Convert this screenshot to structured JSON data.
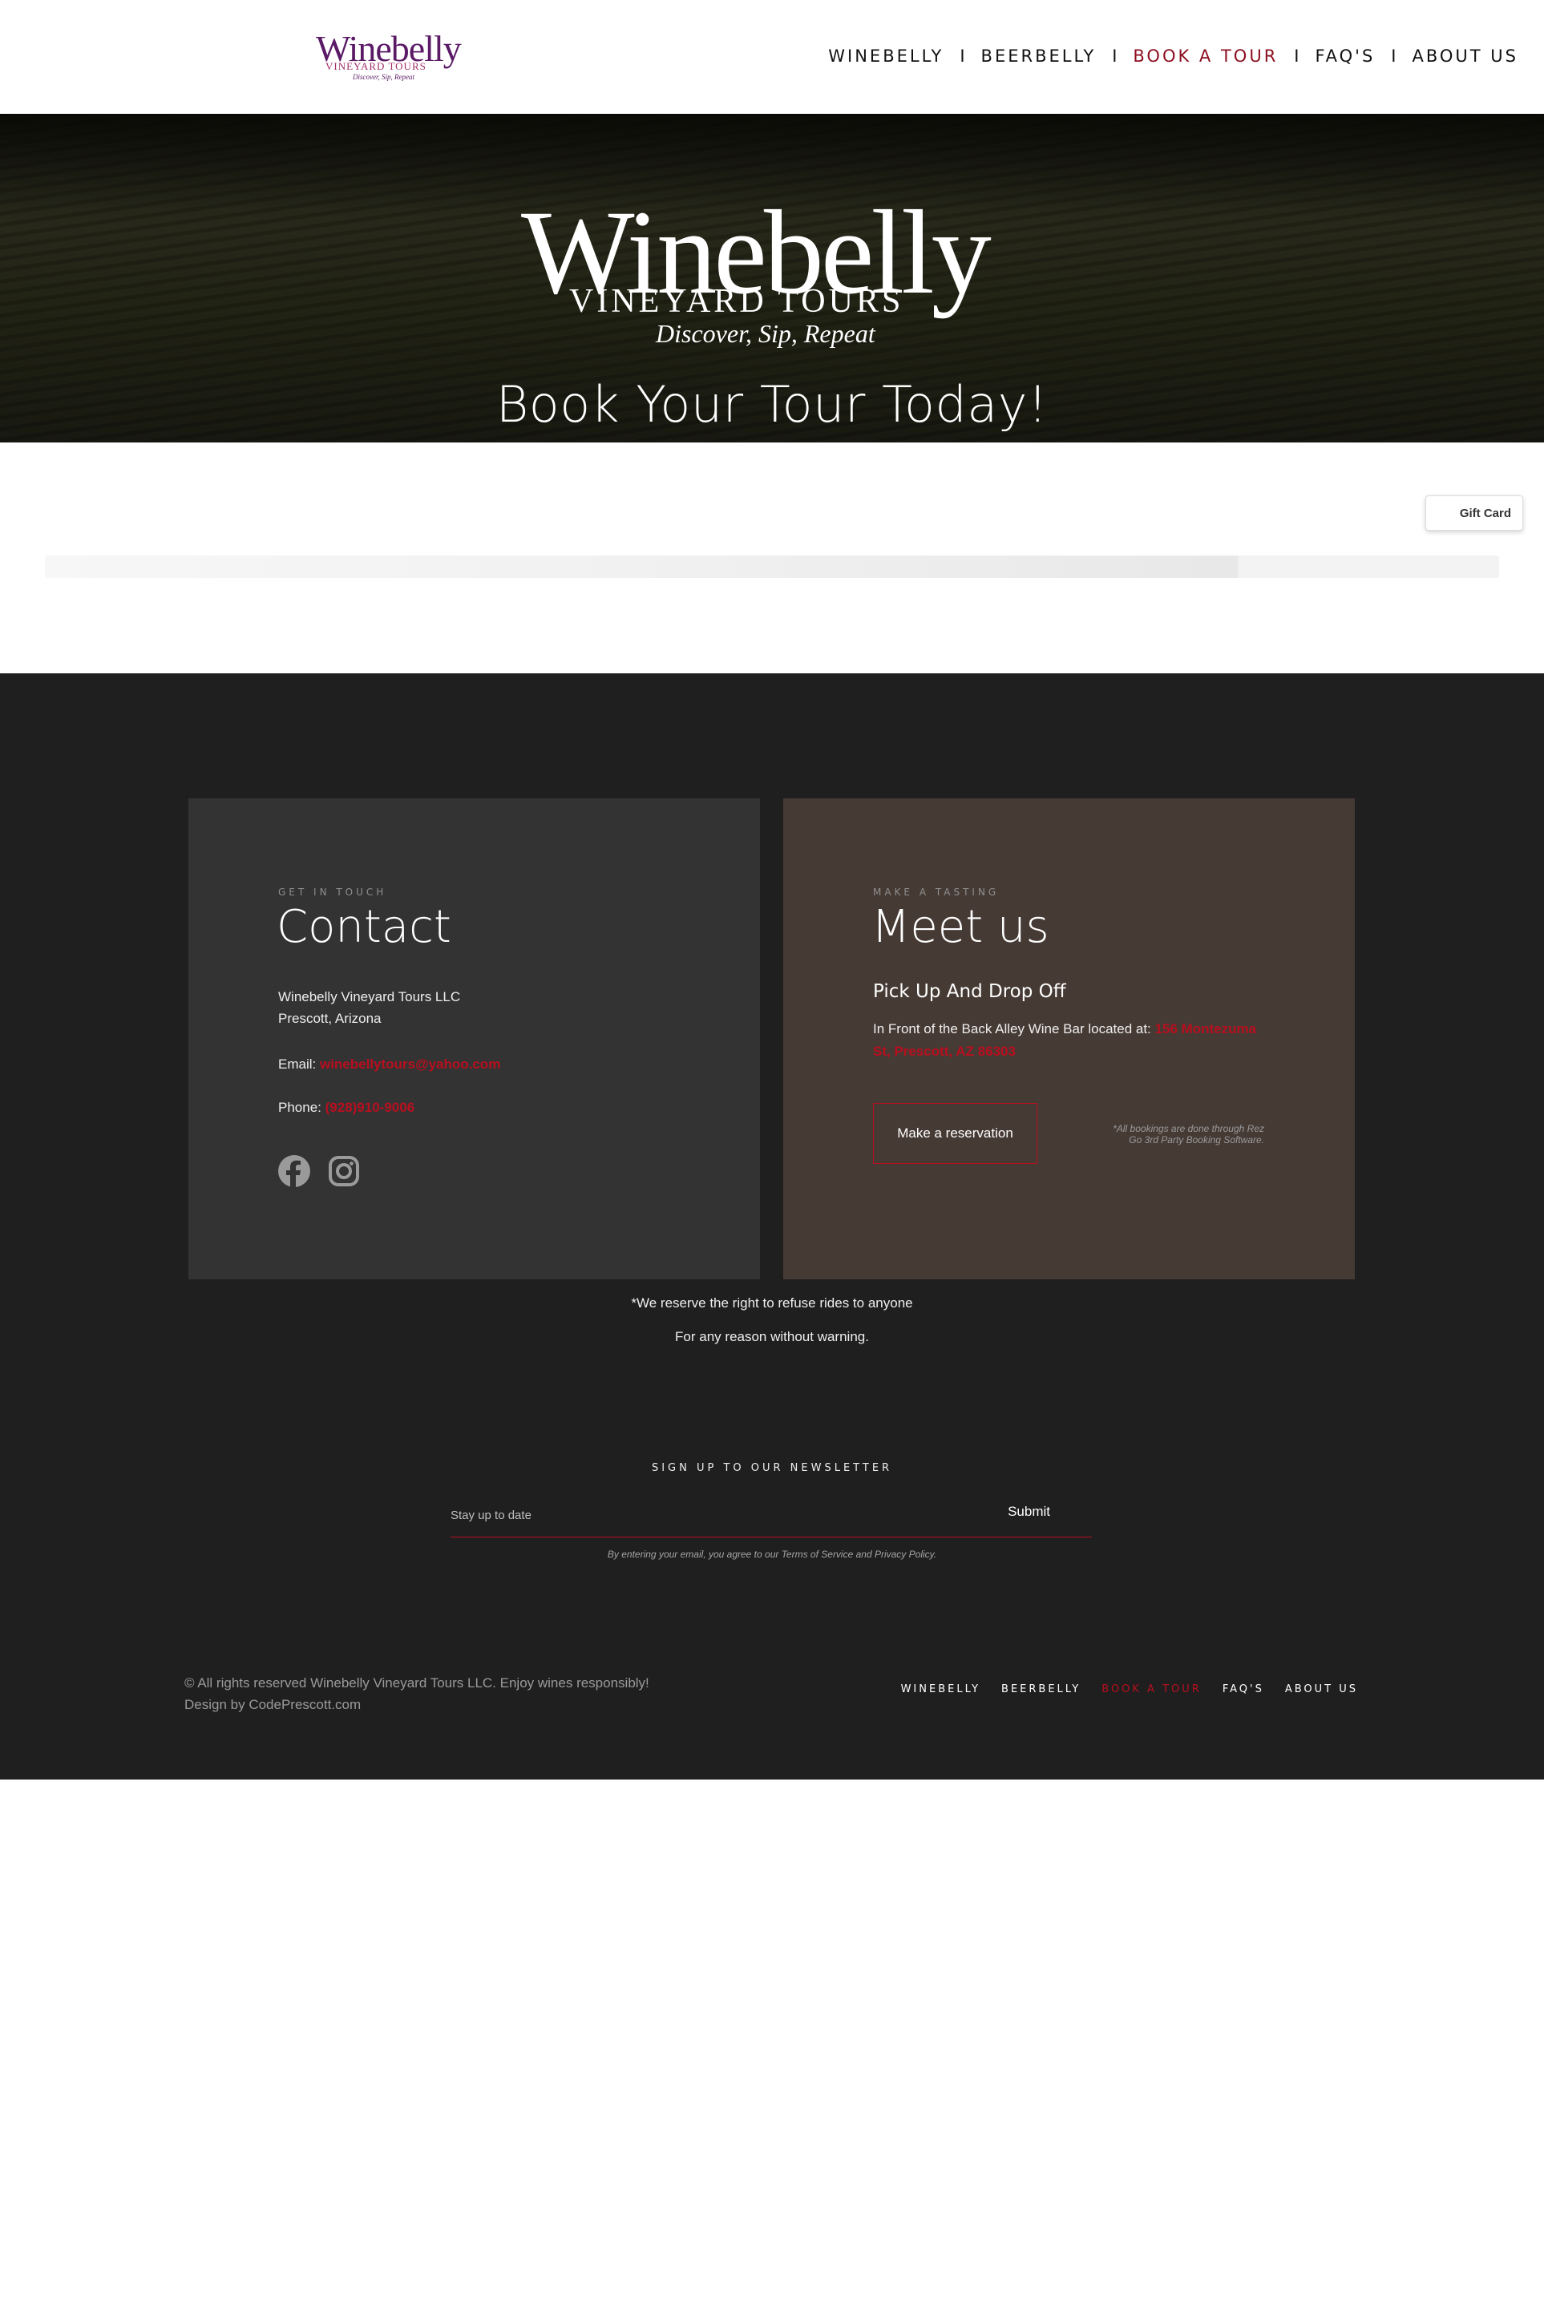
{
  "header": {
    "logo": {
      "main": "Winebelly",
      "sub": "VINEYARD TOURS",
      "tagline": "Discover, Sip, Repeat"
    },
    "nav": [
      {
        "label": "WINEBELLY",
        "active": false
      },
      {
        "label": "BEERBELLY",
        "active": false
      },
      {
        "label": "BOOK A TOUR",
        "active": true
      },
      {
        "label": "FAQ'S",
        "active": false
      },
      {
        "label": "ABOUT US",
        "active": false
      }
    ],
    "separator": "I"
  },
  "hero": {
    "logo": {
      "main": "Winebelly",
      "sub": "VINEYARD TOURS",
      "tagline": "Discover, Sip, Repeat"
    },
    "title": "Book Your Tour Today!"
  },
  "booking": {
    "gift_card_label": "Gift Card"
  },
  "contact": {
    "eyebrow": "GET IN TOUCH",
    "title": "Contact",
    "company": "Winebelly Vineyard Tours LLC",
    "location": "Prescott, Arizona",
    "email_label": "Email:",
    "email_value": "winebellytours@yahoo.com",
    "phone_label": "Phone:",
    "phone_value": "(928)910-9006",
    "social": [
      "facebook-icon",
      "instagram-icon"
    ]
  },
  "meet": {
    "eyebrow": "MAKE A TASTING",
    "title": "Meet us",
    "heading": "Pick Up And Drop Off",
    "text": "In Front of the Back Alley Wine Bar located at:",
    "address": "156 Montezuma St, Prescott, AZ 86303",
    "button": "Make a reservation",
    "note": "*All bookings are done through Rez Go 3rd Party Booking Software."
  },
  "notice": {
    "line1": "*We reserve the right to refuse rides to anyone",
    "line2": "For any reason without warning."
  },
  "newsletter": {
    "label": "SIGN UP TO OUR NEWSLETTER",
    "placeholder": "Stay up to date",
    "submit": "Submit",
    "terms": "By entering your email, you agree to our Terms of Service and Privacy Policy."
  },
  "footer": {
    "copyright": "© All rights reserved Winebelly Vineyard Tours LLC. Enjoy wines responsibly!",
    "design": "Design by CodePrescott.com",
    "nav": [
      {
        "label": "WINEBELLY",
        "active": false
      },
      {
        "label": "BEERBELLY",
        "active": false
      },
      {
        "label": "BOOK A TOUR",
        "active": true
      },
      {
        "label": "FAQ'S",
        "active": false
      },
      {
        "label": "ABOUT US",
        "active": false
      }
    ]
  },
  "colors": {
    "accent": "#b80f1f",
    "nav_active": "#8c0e1f",
    "dark_bg": "#1f1f1f",
    "contact_bg": "#333333",
    "meet_bg": "#463a34"
  }
}
